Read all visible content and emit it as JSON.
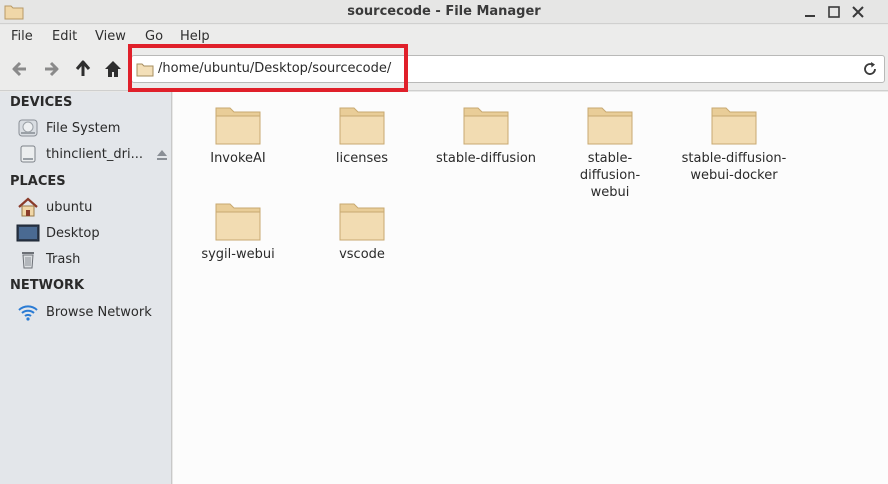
{
  "window": {
    "title": "sourcecode - File Manager"
  },
  "menu": [
    "File",
    "Edit",
    "View",
    "Go",
    "Help"
  ],
  "location": {
    "path": "/home/ubuntu/Desktop/sourcecode/"
  },
  "sidebar": {
    "devices": {
      "heading": "DEVICES",
      "items": [
        "File System",
        "thinclient_dri..."
      ]
    },
    "places": {
      "heading": "PLACES",
      "items": [
        "ubuntu",
        "Desktop",
        "Trash"
      ]
    },
    "network": {
      "heading": "NETWORK",
      "items": [
        "Browse Network"
      ]
    }
  },
  "files": [
    {
      "name": "InvokeAI"
    },
    {
      "name": "licenses"
    },
    {
      "name": "stable-diffusion"
    },
    {
      "name": "stable-diffusion-webui"
    },
    {
      "name": "stable-diffusion-webui-docker"
    },
    {
      "name": "sygil-webui"
    },
    {
      "name": "vscode"
    }
  ],
  "colors": {
    "folder": "#f0d7a8",
    "highlight": "#e0202a",
    "sidebar_bg": "#e3e6ea"
  }
}
